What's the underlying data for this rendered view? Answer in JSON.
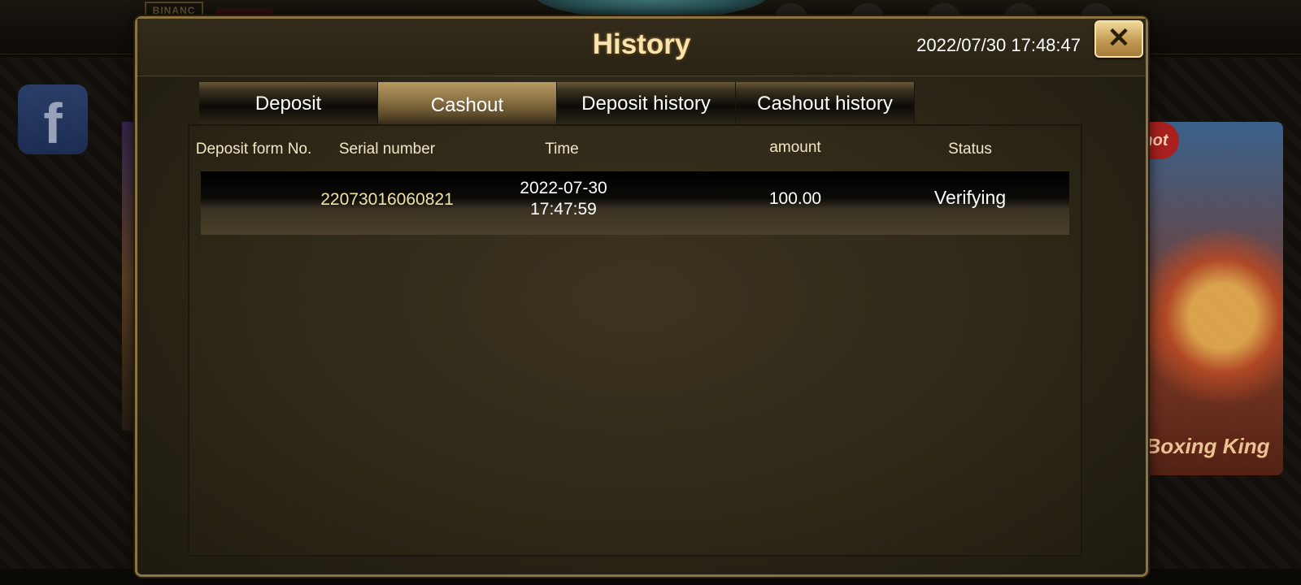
{
  "background": {
    "logo_text": "BINANC",
    "facebook_glyph": "f",
    "game_badge": "hot",
    "game_title": "Boxing King"
  },
  "modal": {
    "title": "History",
    "clock": "2022/07/30 17:48:47",
    "close_label": "✕"
  },
  "tabs": [
    {
      "label": "Deposit",
      "active": false
    },
    {
      "label": "Cashout",
      "active": true
    },
    {
      "label": "Deposit history",
      "active": false
    },
    {
      "label": "Cashout history",
      "active": false
    }
  ],
  "table": {
    "headers": {
      "form_no": "Deposit form No.",
      "serial": "Serial number",
      "time": "Time",
      "amount": "amount",
      "status": "Status"
    },
    "rows": [
      {
        "form_no": "",
        "serial": "22073016060821",
        "date": "2022-07-30",
        "time": "17:47:59",
        "amount": "100.00",
        "status": "Verifying"
      }
    ]
  },
  "colors": {
    "accent_gold": "#c39a52",
    "panel_bg": "#2e2817",
    "serial_text": "#f0e1a6"
  }
}
